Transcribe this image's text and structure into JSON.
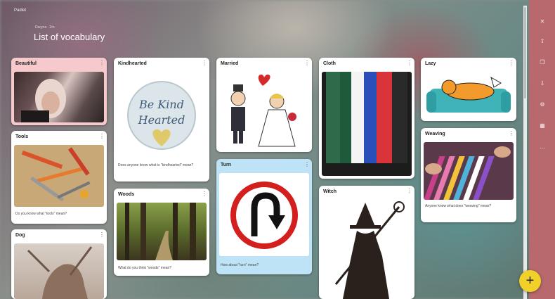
{
  "app": {
    "name": "Padlet"
  },
  "header": {
    "breadcrumb": "Daryna · 2m",
    "title": "List of vocabulary"
  },
  "sidebar": {
    "icons": [
      "close-icon",
      "share-icon",
      "copy-icon",
      "download-icon",
      "settings-icon",
      "grid-icon",
      "more-icon"
    ]
  },
  "fab": {
    "label": "+"
  },
  "cards": {
    "beautiful": {
      "title": "Beautiful",
      "menu": "⋮"
    },
    "tools": {
      "title": "Tools",
      "menu": "⋮",
      "text": "Do you know what \"tools\" mean?"
    },
    "dog": {
      "title": "Dog",
      "menu": "⋮"
    },
    "kindhearted": {
      "title": "Kindhearted",
      "menu": "⋮",
      "img_line1": "Be Kind",
      "img_line2": "Hearted",
      "text": "Does anyone know what is \"kindhearted\" mean?"
    },
    "woods": {
      "title": "Woods",
      "menu": "⋮",
      "text": "What do you think \"woods\" mean?"
    },
    "married": {
      "title": "Married",
      "menu": "⋮"
    },
    "turn": {
      "title": "Turn",
      "menu": "⋮",
      "text": "How about \"turn\" mean?"
    },
    "cloth": {
      "title": "Cloth",
      "menu": "⋮"
    },
    "witch": {
      "title": "Witch",
      "menu": "⋮"
    },
    "lazy": {
      "title": "Lazy",
      "menu": "⋮"
    },
    "weaving": {
      "title": "Weaving",
      "menu": "⋮",
      "text": "Anyone know what does \"weaving\" mean?"
    }
  },
  "colors": {
    "sidebar": "#b8696e",
    "fab": "#f2d02a",
    "beautiful_card": "#f6c9cc",
    "turn_card": "#bfe3f6"
  }
}
